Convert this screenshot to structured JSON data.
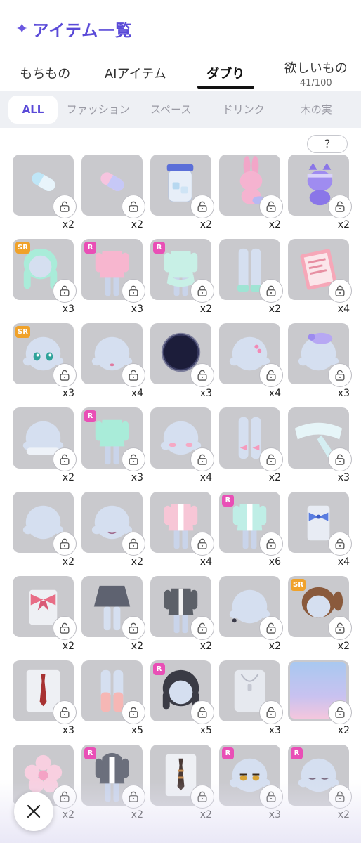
{
  "header": {
    "title": "アイテム一覧"
  },
  "tabs": [
    {
      "label": "もちもの",
      "sub": "",
      "active": false
    },
    {
      "label": "AIアイテム",
      "sub": "",
      "active": false
    },
    {
      "label": "ダブり",
      "sub": "",
      "active": true
    },
    {
      "label": "欲しいもの",
      "sub": "41/100",
      "active": false
    }
  ],
  "categories": [
    {
      "label": "ALL",
      "active": true
    },
    {
      "label": "ファッション",
      "active": false
    },
    {
      "label": "スペース",
      "active": false
    },
    {
      "label": "ドリンク",
      "active": false
    },
    {
      "label": "木の実",
      "active": false
    }
  ],
  "help_label": "?",
  "items": [
    {
      "art": "capsule",
      "count": "x2",
      "badge": ""
    },
    {
      "art": "capsule-pink",
      "count": "x2",
      "badge": ""
    },
    {
      "art": "jar",
      "count": "x2",
      "badge": ""
    },
    {
      "art": "bunny",
      "count": "x2",
      "badge": ""
    },
    {
      "art": "cat",
      "count": "x2",
      "badge": ""
    },
    {
      "art": "hair-mint",
      "count": "x3",
      "badge": "SR"
    },
    {
      "art": "outfit-pink",
      "count": "x3",
      "badge": "R"
    },
    {
      "art": "outfit-mint",
      "count": "x2",
      "badge": "R"
    },
    {
      "art": "legs-mint",
      "count": "x2",
      "badge": ""
    },
    {
      "art": "book",
      "count": "x4",
      "badge": ""
    },
    {
      "art": "face-eyes",
      "count": "x3",
      "badge": "SR"
    },
    {
      "art": "face-mouth",
      "count": "x4",
      "badge": ""
    },
    {
      "art": "face-dark",
      "count": "x3",
      "badge": ""
    },
    {
      "art": "face-pins",
      "count": "x4",
      "badge": ""
    },
    {
      "art": "face-plush",
      "count": "x3",
      "badge": ""
    },
    {
      "art": "face-mask",
      "count": "x2",
      "badge": ""
    },
    {
      "art": "outfit-mint2",
      "count": "x3",
      "badge": "R"
    },
    {
      "art": "face-blush",
      "count": "x4",
      "badge": ""
    },
    {
      "art": "legs-bow",
      "count": "x2",
      "badge": ""
    },
    {
      "art": "scarf",
      "count": "x3",
      "badge": ""
    },
    {
      "art": "face-plain",
      "count": "x2",
      "badge": ""
    },
    {
      "art": "face-smile",
      "count": "x2",
      "badge": ""
    },
    {
      "art": "jacket-pink",
      "count": "x4",
      "badge": ""
    },
    {
      "art": "jacket-mint",
      "count": "x6",
      "badge": "R"
    },
    {
      "art": "bow-blue",
      "count": "x4",
      "badge": ""
    },
    {
      "art": "bow-red",
      "count": "x2",
      "badge": ""
    },
    {
      "art": "skirt-gray",
      "count": "x2",
      "badge": ""
    },
    {
      "art": "blazer-black",
      "count": "x2",
      "badge": ""
    },
    {
      "art": "face-earring",
      "count": "x2",
      "badge": ""
    },
    {
      "art": "hair-brown",
      "count": "x2",
      "badge": "SR"
    },
    {
      "art": "tie-red",
      "count": "x3",
      "badge": ""
    },
    {
      "art": "socks-pink",
      "count": "x5",
      "badge": ""
    },
    {
      "art": "hair-black",
      "count": "x5",
      "badge": "R"
    },
    {
      "art": "necklace",
      "count": "x3",
      "badge": ""
    },
    {
      "art": "sky",
      "count": "x2",
      "badge": ""
    },
    {
      "art": "flower",
      "count": "x2",
      "badge": ""
    },
    {
      "art": "hoodie-gray",
      "count": "x2",
      "badge": "R"
    },
    {
      "art": "tie-stripe",
      "count": "x2",
      "badge": ""
    },
    {
      "art": "face-gold",
      "count": "x3",
      "badge": "R"
    },
    {
      "art": "face-sleep",
      "count": "x2",
      "badge": "R"
    }
  ]
}
